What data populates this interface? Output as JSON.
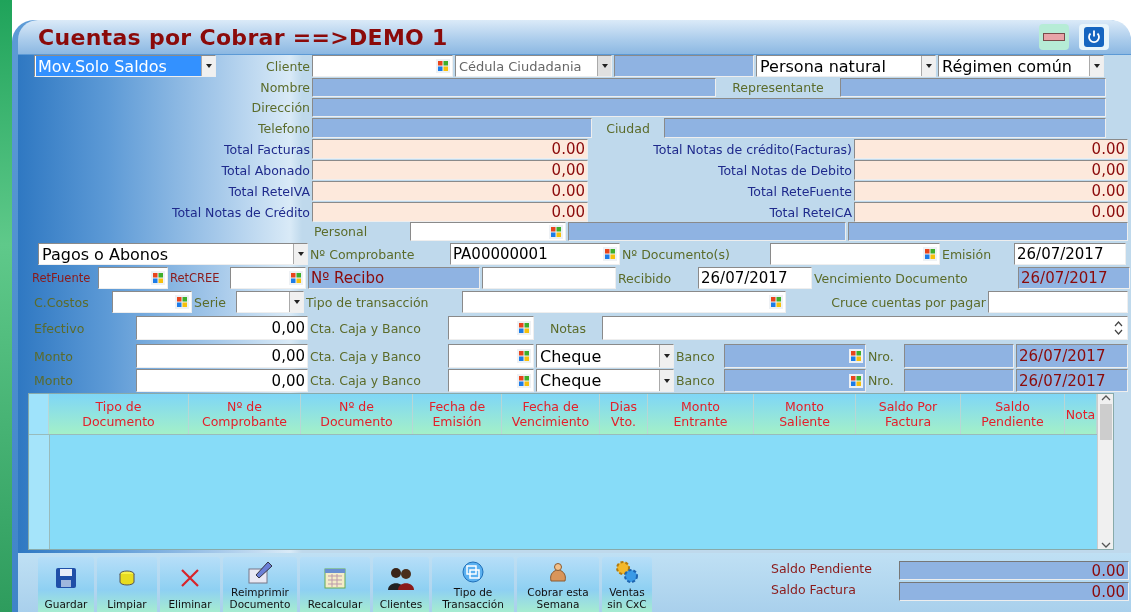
{
  "window": {
    "title": "Cuentas por Cobrar ==>DEMO 1"
  },
  "form_rows": [
    [
      {
        "kind": "select",
        "value": "Mov.Solo Saldos",
        "highlighted": true,
        "disabled": false
      },
      {
        "kind": "label",
        "text": "Cliente"
      },
      {
        "kind": "lookup",
        "readonly": false
      },
      {
        "kind": "select",
        "value": "Cédula Ciudadania",
        "highlighted": false,
        "disabled": true
      },
      {
        "kind": "readonly"
      },
      {
        "kind": "select",
        "value": "Persona natural",
        "highlighted": false,
        "disabled": false
      },
      {
        "kind": "select",
        "value": "Régimen común",
        "highlighted": false,
        "disabled": false
      }
    ],
    [
      {
        "kind": "label",
        "text": "Nombre"
      },
      {
        "kind": "readonly"
      },
      {
        "kind": "label",
        "text": "Representante"
      },
      {
        "kind": "readonly"
      }
    ],
    [
      {
        "kind": "label",
        "text": "Dirección"
      },
      {
        "kind": "readonly"
      }
    ],
    [
      {
        "kind": "label",
        "text": "Telefono"
      },
      {
        "kind": "readonly"
      },
      {
        "kind": "label",
        "text": "Ciudad"
      },
      {
        "kind": "readonly"
      }
    ],
    [
      {
        "kind": "total",
        "text": "Total Facturas"
      },
      {
        "kind": "amount",
        "value": "0.00"
      },
      {
        "kind": "total",
        "text": "Total Notas de crédito(Facturas)"
      },
      {
        "kind": "amount",
        "value": "0.00"
      }
    ],
    [
      {
        "kind": "total",
        "text": "Total Abonado"
      },
      {
        "kind": "amount",
        "value": "0,00"
      },
      {
        "kind": "total",
        "text": "Total Notas de Debito"
      },
      {
        "kind": "amount",
        "value": "0,00"
      }
    ],
    [
      {
        "kind": "total",
        "text": "Total ReteIVA"
      },
      {
        "kind": "amount",
        "value": "0.00"
      },
      {
        "kind": "total",
        "text": "Total ReteFuente"
      },
      {
        "kind": "amount",
        "value": "0.00"
      }
    ],
    [
      {
        "kind": "total",
        "text": "Total Notas de Crédito"
      },
      {
        "kind": "amount",
        "value": "0.00"
      },
      {
        "kind": "total",
        "text": "Total ReteICA"
      },
      {
        "kind": "amount",
        "value": "0.00"
      }
    ],
    [
      {
        "kind": "label",
        "text": "Personal"
      },
      {
        "kind": "lookup",
        "readonly": false
      },
      {
        "kind": "readonly"
      },
      {
        "kind": "readonly"
      }
    ],
    [
      {
        "kind": "select",
        "value": "Pagos o Abonos",
        "highlighted": false,
        "disabled": false
      },
      {
        "kind": "label",
        "text": "Nº Comprobante"
      },
      {
        "kind": "lookup",
        "readonly": false,
        "value": "PA00000001"
      },
      {
        "kind": "label",
        "text": "Nº Documento(s)"
      },
      {
        "kind": "lookup",
        "readonly": false
      },
      {
        "kind": "label",
        "text": "Emisión"
      },
      {
        "kind": "date",
        "value": "26/07/2017"
      }
    ],
    [
      {
        "kind": "tax",
        "text": "RetFuente"
      },
      {
        "kind": "lookup",
        "readonly": false
      },
      {
        "kind": "tax",
        "text": "RetCREE"
      },
      {
        "kind": "lookup",
        "readonly": false
      },
      {
        "kind": "readonly",
        "value": "Nº Recibo"
      },
      {
        "kind": "text"
      },
      {
        "kind": "label",
        "text": "Recibido"
      },
      {
        "kind": "date",
        "value": "26/07/2017"
      },
      {
        "kind": "label",
        "text": "Vencimiento Documento"
      },
      {
        "kind": "readonly",
        "value": "26/07/2017"
      }
    ],
    [
      {
        "kind": "label",
        "text": "C.Costos"
      },
      {
        "kind": "lookup",
        "readonly": false
      },
      {
        "kind": "label",
        "text": "Serie"
      },
      {
        "kind": "select",
        "highlighted": false,
        "disabled": false
      },
      {
        "kind": "label",
        "text": "Tipo de transacción"
      },
      {
        "kind": "lookup",
        "readonly": false
      },
      {
        "kind": "label",
        "text": "Cruce cuentas por pagar"
      },
      {
        "kind": "text"
      }
    ],
    [
      {
        "kind": "label",
        "text": "Efectivo"
      },
      {
        "kind": "money",
        "value": "0,00"
      },
      {
        "kind": "label",
        "text": "Cta. Caja y Banco"
      },
      {
        "kind": "lookup",
        "readonly": false
      },
      {
        "kind": "label",
        "text": "Notas"
      },
      {
        "kind": "memo"
      }
    ],
    [
      {
        "kind": "label",
        "text": "Monto"
      },
      {
        "kind": "money",
        "value": "0,00"
      },
      {
        "kind": "label",
        "text": "Cta. Caja y Banco"
      },
      {
        "kind": "lookup",
        "readonly": false
      },
      {
        "kind": "select",
        "value": "Cheque",
        "highlighted": false,
        "disabled": false
      },
      {
        "kind": "label",
        "text": "Banco"
      },
      {
        "kind": "lookup",
        "readonly": true
      },
      {
        "kind": "label",
        "text": "Nro."
      },
      {
        "kind": "readonly"
      },
      {
        "kind": "readonly",
        "value": "26/07/2017"
      }
    ],
    [
      {
        "kind": "label",
        "text": "Monto"
      },
      {
        "kind": "money",
        "value": "0,00"
      },
      {
        "kind": "label",
        "text": "Cta. Caja y Banco"
      },
      {
        "kind": "lookup",
        "readonly": false
      },
      {
        "kind": "select",
        "value": "Cheque",
        "highlighted": false,
        "disabled": false
      },
      {
        "kind": "label",
        "text": "Banco"
      },
      {
        "kind": "lookup",
        "readonly": true
      },
      {
        "kind": "label",
        "text": "Nro."
      },
      {
        "kind": "readonly"
      },
      {
        "kind": "readonly",
        "value": "26/07/2017"
      }
    ]
  ],
  "table": {
    "columns": [
      "Tipo de Documento",
      "Nº de Comprobante",
      "Nº de Documento",
      "Fecha de Emisión",
      "Fecha de Vencimiento",
      "Dias Vto.",
      "Monto Entrante",
      "Monto Saliente",
      "Saldo Por Factura",
      "Saldo Pendiente",
      "Nota"
    ]
  },
  "toolbar": [
    {
      "label": "Guardar"
    },
    {
      "label": "Limpiar"
    },
    {
      "label": "Eliminar"
    },
    {
      "label": "Reimprimir Documento"
    },
    {
      "label": "Recalcular"
    },
    {
      "label": "Clientes"
    },
    {
      "label": "Tipo de Transacción"
    },
    {
      "label": "Cobrar esta Semana"
    },
    {
      "label": "Ventas sin CxC"
    }
  ],
  "summary": [
    {
      "label": "Saldo Pendiente",
      "value": "0.00"
    },
    {
      "label": "Saldo Factura",
      "value": "0.00"
    }
  ]
}
